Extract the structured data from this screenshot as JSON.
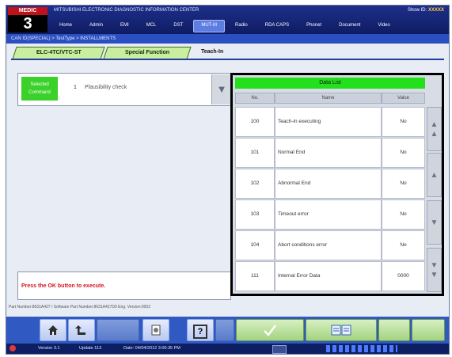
{
  "header": {
    "brand": "MEDIC",
    "version_big": "3",
    "system_name": "MITSUBISHI ELECTRONIC DIAGNOSTIC INFORMATION CENTER",
    "user_label": "Show ID:",
    "user_id": "XXXXX",
    "nav": [
      "Home",
      "Admin",
      "EMI",
      "MCL",
      "DST",
      "MUT-III",
      "Radio",
      "RDA CAPS",
      "Phonet",
      "Document",
      "Video"
    ],
    "active_nav": "MUT-III"
  },
  "breadcrumb": "CAN ID(SPECIAL) > TestType > INSTALLMENTS",
  "tabs": [
    "ELC-4TC/VTC-ST",
    "Special Function",
    "Teach-In"
  ],
  "command": {
    "label": "Selected Command",
    "number": "1",
    "value": "Plausibility check"
  },
  "data_list": {
    "title": "Data List",
    "headers": [
      "No.",
      "Name",
      "Value"
    ],
    "rows": [
      {
        "no": "100",
        "name": "Teach-in executing",
        "value": "No"
      },
      {
        "no": "101",
        "name": "Normal End",
        "value": "No"
      },
      {
        "no": "102",
        "name": "Abnormal End",
        "value": "No"
      },
      {
        "no": "103",
        "name": "Timeout error",
        "value": "No"
      },
      {
        "no": "104",
        "name": "Abort conditions error",
        "value": "No"
      },
      {
        "no": "111",
        "name": "Internal Error Data",
        "value": "0000"
      }
    ]
  },
  "message": "Press the OK button to execute.",
  "part_number": "Part Number:8631A427 / Software Part Number:8631A427D0 Eng. Version:0002",
  "toolbar": {
    "help_label": "?"
  },
  "status": {
    "version": "Version 3.1",
    "update": "Update 113",
    "date": "Date: 04/04/2012 3:00:35 PM"
  },
  "colors": {
    "header_blue": "#1d2f8a",
    "selected_green": "#22e01c",
    "tab_green": "#c9eea0",
    "message_red": "#d4151d",
    "toolbar_blue": "#3059c2"
  }
}
